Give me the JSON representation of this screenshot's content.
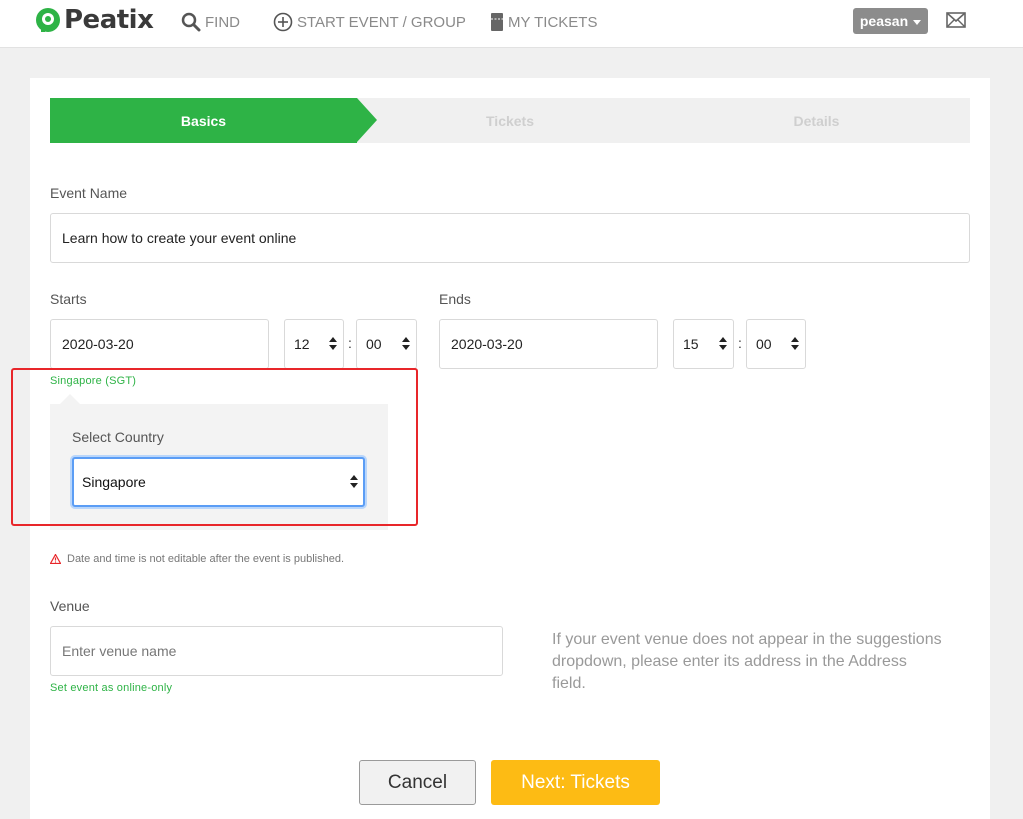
{
  "header": {
    "logo_text": "Peatix",
    "nav": [
      {
        "label": "FIND",
        "icon": "search-icon"
      },
      {
        "label": "START EVENT / GROUP",
        "icon": "plus-circle-icon"
      },
      {
        "label": "MY TICKETS",
        "icon": "ticket-icon"
      }
    ],
    "user_label": "peasan",
    "mail_icon": "mail-icon"
  },
  "steps": [
    "Basics",
    "Tickets",
    "Details"
  ],
  "form": {
    "event_name_label": "Event Name",
    "event_name_value": "Learn how to create your event online",
    "starts_label": "Starts",
    "ends_label": "Ends",
    "start_date": "2020-03-20",
    "start_hour": "12",
    "start_minute": "00",
    "end_date": "2020-03-20",
    "end_hour": "15",
    "end_minute": "00",
    "time_separator": ":",
    "timezone_link": "Singapore (SGT)",
    "select_country_label": "Select Country",
    "country_value": "Singapore",
    "warning_text": "Date and time is not editable after the event is published.",
    "venue_label": "Venue",
    "venue_placeholder": "Enter venue name",
    "online_only_link": "Set event as online-only",
    "venue_help": "If your event venue does not appear in the suggestions dropdown, please enter its address in the Address field."
  },
  "buttons": {
    "cancel": "Cancel",
    "next": "Next: Tickets"
  },
  "colors": {
    "brand_green": "#2eb346",
    "next_yellow": "#fdbb14",
    "highlight_red": "#e8262a"
  }
}
